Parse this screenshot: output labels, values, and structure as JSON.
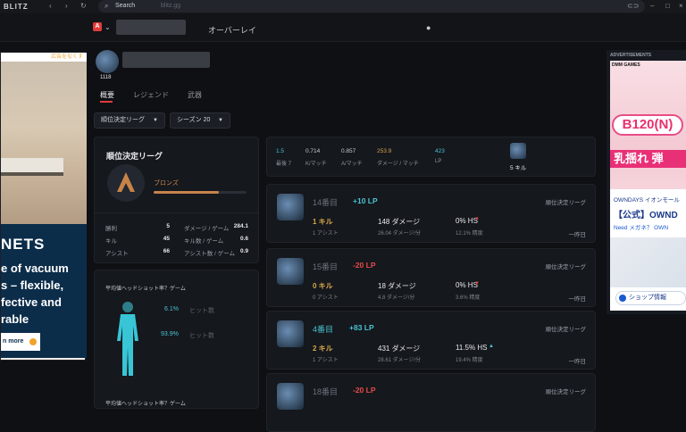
{
  "titlebar": {
    "app": "BLITZ",
    "search_label": "Search",
    "search_url": "blitz.gg"
  },
  "navbar": {
    "title": "オーバーレイ"
  },
  "ads": {
    "left": {
      "hide_label": "広告をなくす",
      "brand": "NETS",
      "copy": "e of vacuum\ns – flexible,\nfective and\nrable",
      "more": "n more"
    },
    "right": {
      "label": "ADVERTISEMENTS",
      "brand": "DMM GAMES",
      "b120": "B120(N)",
      "shake": "乳揺れ 弾",
      "owndays": "OWNDAYS イオンモール",
      "owndays_title": "【公式】OWND",
      "owndays_sub": "Need メガネ？ OWN",
      "shop": "ショップ情報"
    }
  },
  "player": {
    "level": "1118"
  },
  "tabs": [
    "概要",
    "レジェンド",
    "武器"
  ],
  "filters": {
    "league": "順位決定リーグ",
    "season": "シーズン 20"
  },
  "rank": {
    "title": "順位決定リーグ",
    "name": "ブロンズ",
    "progress": 0.7,
    "stats": [
      {
        "label": "勝利",
        "value": "5",
        "label2": "ダメージ / ゲーム",
        "value2": "284.1"
      },
      {
        "label": "キル",
        "value": "45",
        "label2": "キル数 / ゲーム",
        "value2": "0.6"
      },
      {
        "label": "アシスト",
        "value": "66",
        "label2": "アシスト数 / ゲーム",
        "value2": "0.9"
      }
    ]
  },
  "headshot": {
    "title": "平均値ヘッドショット率？ゲーム",
    "pct1": "6.1%",
    "pct1_label": "ヒット数",
    "pct2": "93.9%",
    "pct2_label": "ヒット数",
    "bottom": "平均値ヘッドショット率？ゲーム"
  },
  "summary": {
    "items": [
      {
        "value": "1.5",
        "label": "最後 7",
        "up": true
      },
      {
        "value": "0.714",
        "label": "K/マッチ"
      },
      {
        "value": "0.857",
        "label": "A/マッチ"
      },
      {
        "value": "253.9",
        "label": "ダメージ / マッチ",
        "gold": true
      },
      {
        "value": "423",
        "label": "LP",
        "up": true
      }
    ],
    "kills": "5 キル"
  },
  "matches": [
    {
      "place": "14番目",
      "lp": "+10 LP",
      "mode": "順位決定リーグ",
      "kills": "1 キル",
      "assists": "1 アシスト",
      "damage": "148 ダメージ",
      "dpm": "26.04 ダメージ/分",
      "hs": "0% HS",
      "acc": "12.1% 精度",
      "date": "一昨日",
      "lp_up": true,
      "kills_gold": true,
      "hs_up": false
    },
    {
      "place": "15番目",
      "lp": "-20 LP",
      "mode": "順位決定リーグ",
      "kills": "0 キル",
      "assists": "0 アシスト",
      "damage": "18 ダメージ",
      "dpm": "4.8 ダメージ/分",
      "hs": "0% HS",
      "acc": "3.6% 精度",
      "date": "一昨日",
      "lp_up": false,
      "kills_gold": true,
      "hs_up": false
    },
    {
      "place": "4番目",
      "lp": "+83 LP",
      "mode": "順位決定リーグ",
      "kills": "2 キル",
      "assists": "1 アシスト",
      "damage": "431 ダメージ",
      "dpm": "28.61 ダメージ/分",
      "hs": "11.5% HS",
      "acc": "19.4% 精度",
      "date": "一昨日",
      "lp_up": true,
      "kills_gold": true,
      "hs_up": true,
      "place_up": true
    },
    {
      "place": "18番目",
      "lp": "-20 LP",
      "mode": "順位決定リーグ",
      "kills": "",
      "assists": "",
      "damage": "",
      "dpm": "",
      "hs": "",
      "acc": "",
      "date": "",
      "lp_up": false
    }
  ]
}
